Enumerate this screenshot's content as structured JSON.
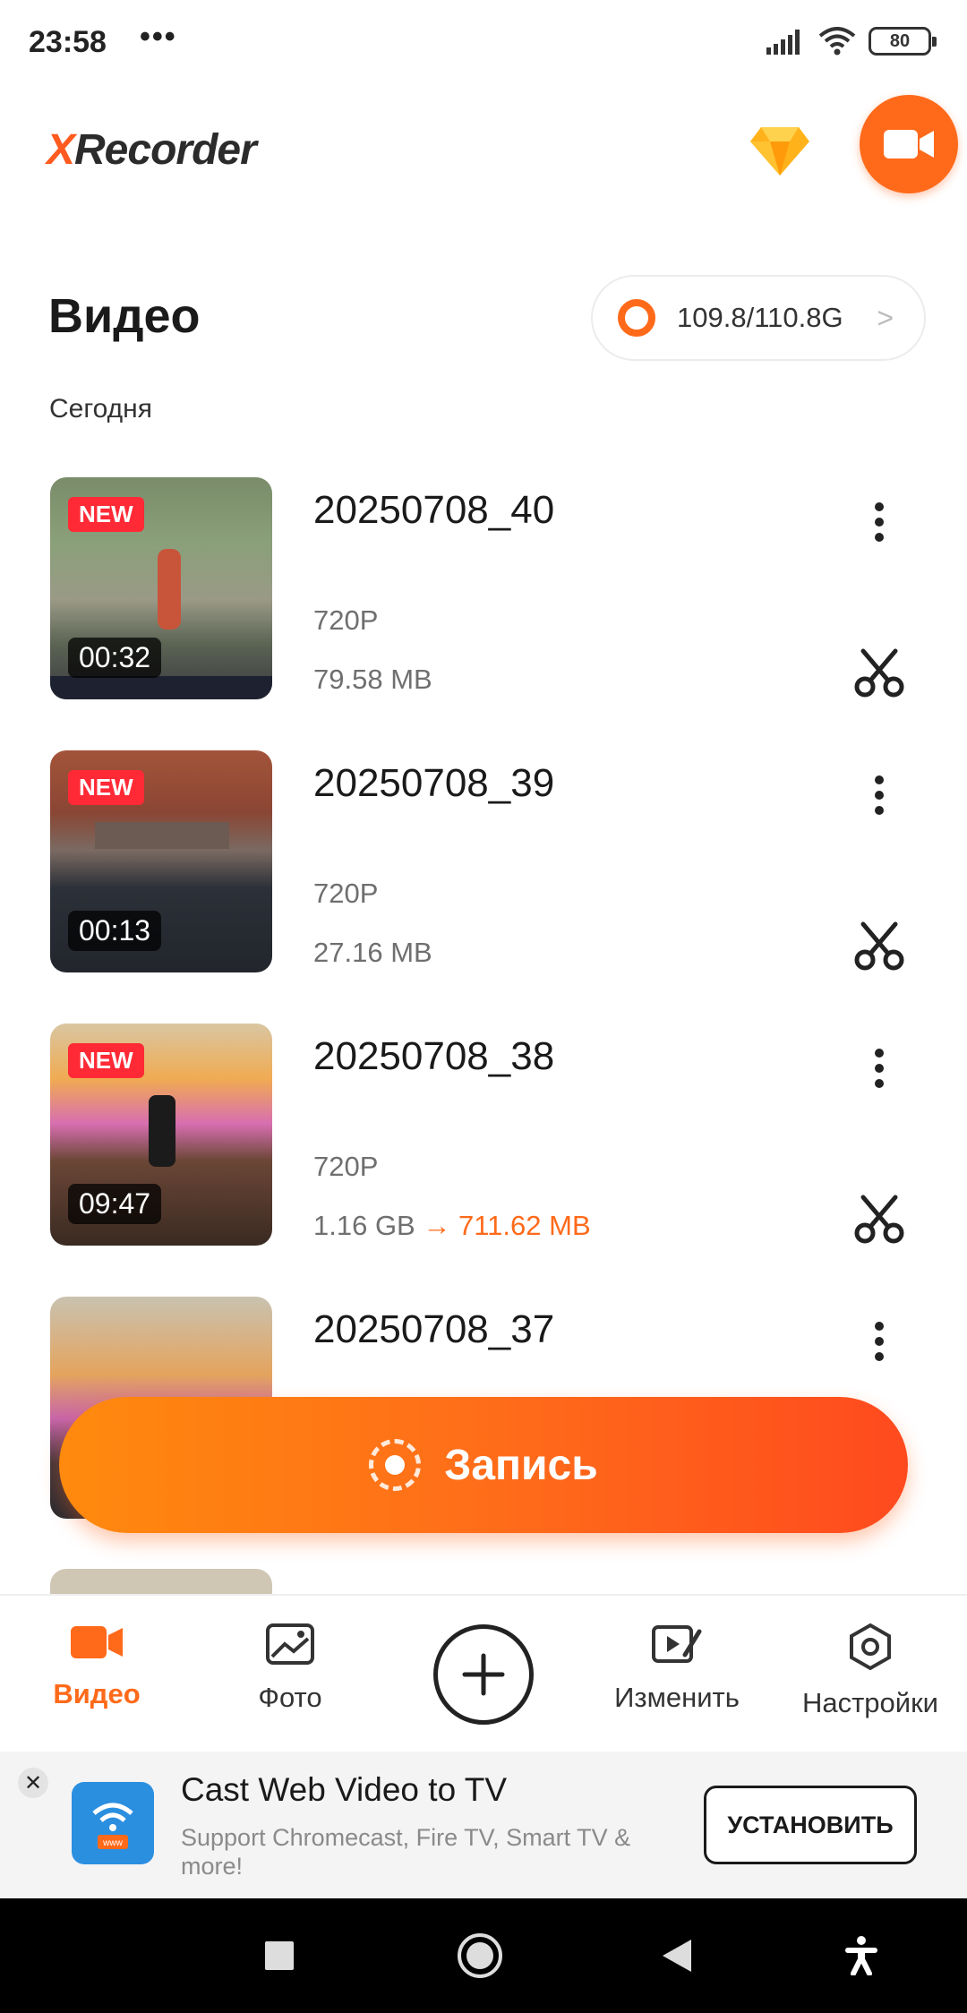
{
  "status_bar": {
    "time": "23:58",
    "dots": "•••",
    "battery": "80"
  },
  "header": {
    "logo_x": "X",
    "logo_rest": "Recorder"
  },
  "page": {
    "title": "Видео",
    "storage": "109.8/110.8G",
    "storage_chevron": ">",
    "section": "Сегодня"
  },
  "videos": [
    {
      "name": "20250708_40",
      "badge": "NEW",
      "duration": "00:32",
      "resolution": "720P",
      "size": "79.58 MB"
    },
    {
      "name": "20250708_39",
      "badge": "NEW",
      "duration": "00:13",
      "resolution": "720P",
      "size": "27.16 MB"
    },
    {
      "name": "20250708_38",
      "badge": "NEW",
      "duration": "09:47",
      "resolution": "720P",
      "size": "1.16 GB",
      "arrow": "→",
      "compressed_size": "711.62 MB"
    },
    {
      "name": "20250708_37"
    }
  ],
  "record_button": {
    "label": "Запись"
  },
  "bottom_nav": {
    "video": "Видео",
    "photo": "Фото",
    "edit": "Изменить",
    "settings": "Настройки"
  },
  "ad": {
    "close": "✕",
    "title": "Cast Web Video to TV",
    "subtitle": "Support Chromecast, Fire TV, Smart TV & more!",
    "install": "УСТАНОВИТЬ",
    "icon_text": "www"
  },
  "colors": {
    "accent": "#ff6a1a",
    "badge": "#ff2a36"
  }
}
